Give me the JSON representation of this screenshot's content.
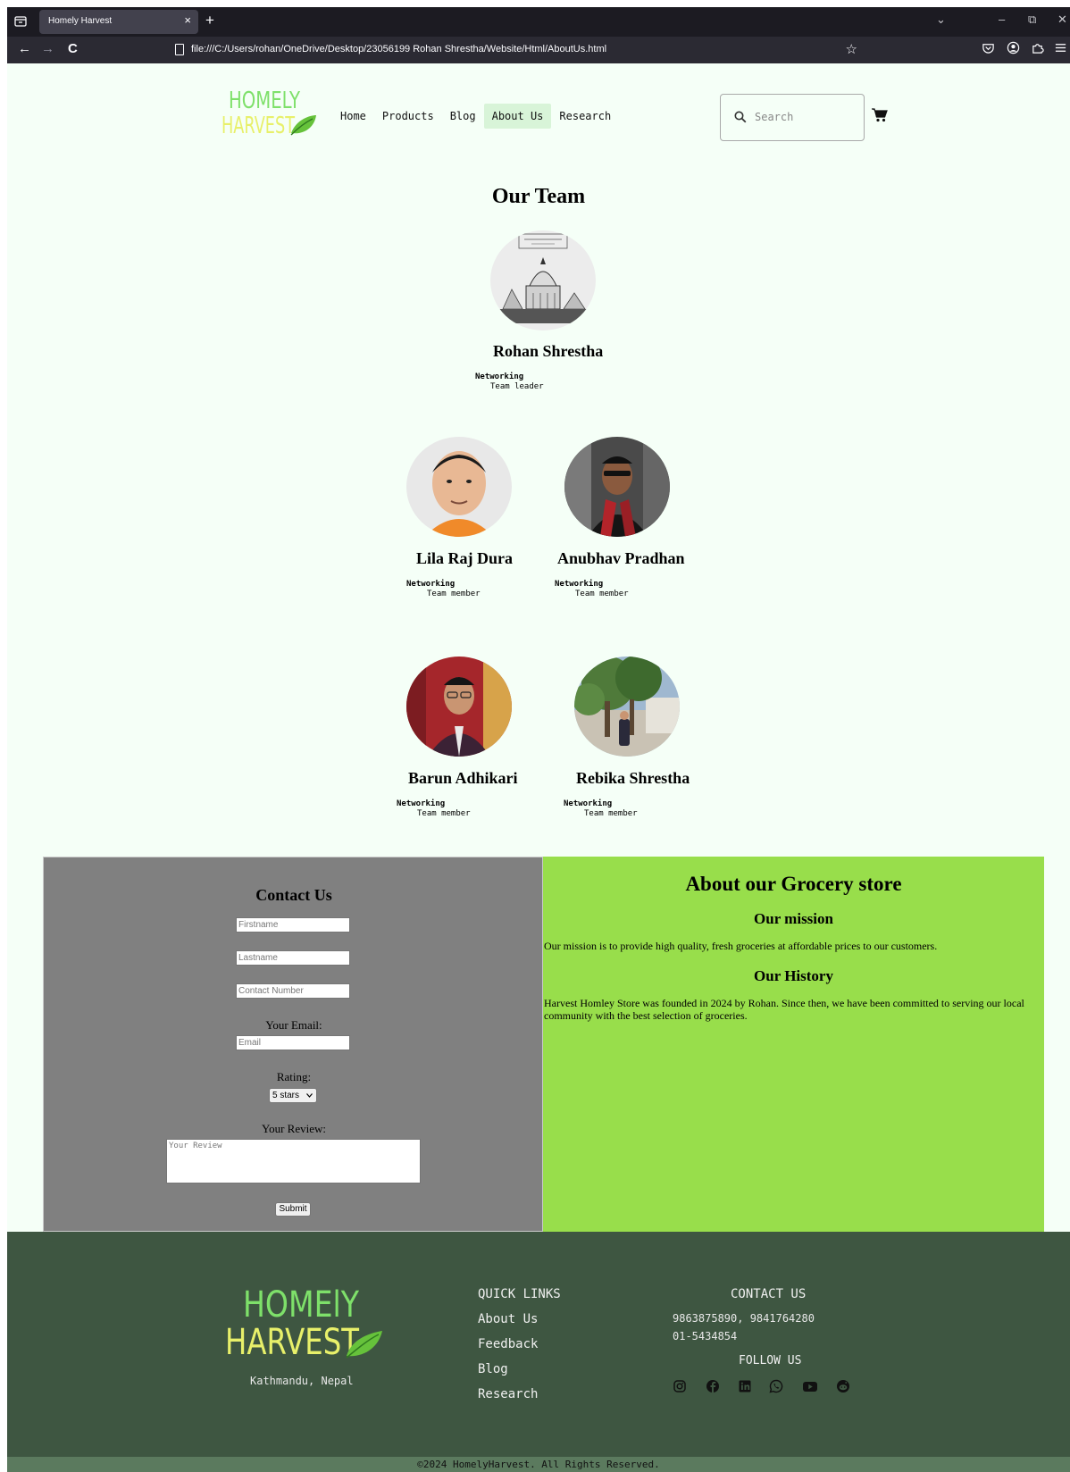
{
  "browser": {
    "tab_title": "Homely Harvest",
    "tab_close": "×",
    "new_tab": "+",
    "url": "file:///C:/Users/rohan/OneDrive/Desktop/23056199 Rohan Shrestha/Website/Html/AboutUs.html",
    "back": "←",
    "forward": "→",
    "reload": "C",
    "star": "☆",
    "win_list": "⌄",
    "win_min": "–",
    "win_restore": "⧉",
    "win_close": "✕"
  },
  "header": {
    "logo_line1": "HOMELY",
    "logo_line2": "HARVEST",
    "menu": [
      {
        "label": "Home"
      },
      {
        "label": "Products"
      },
      {
        "label": "Blog"
      },
      {
        "label": "About Us"
      },
      {
        "label": "Research"
      }
    ],
    "search_placeholder": "Search"
  },
  "team": {
    "title": "Our Team",
    "members": [
      {
        "name": "Rohan Shrestha",
        "dept": "Networking",
        "role": "Team leader"
      },
      {
        "name": "Lila Raj Dura",
        "dept": "Networking",
        "role": "Team member"
      },
      {
        "name": "Anubhav Pradhan",
        "dept": "Networking",
        "role": "Team member"
      },
      {
        "name": "Barun Adhikari",
        "dept": "Networking",
        "role": "Team member"
      },
      {
        "name": "Rebika Shrestha",
        "dept": "Networking",
        "role": "Team member"
      }
    ]
  },
  "contact": {
    "title": "Contact Us",
    "firstname_placeholder": "Firstname",
    "lastname_placeholder": "Lastname",
    "contact_placeholder": "Contact Number",
    "email_label": "Your Email:",
    "email_placeholder": "Email",
    "rating_label": "Rating:",
    "rating_value": "5 stars",
    "review_label": "Your Review:",
    "review_placeholder": "Your Review",
    "submit_label": "Submit"
  },
  "about": {
    "title": "About our Grocery store",
    "mission_heading": "Our mission",
    "mission_text": "Our mission is to provide high quality, fresh groceries at affordable prices to our customers.",
    "history_heading": "Our History",
    "history_text": "Harvest Homley Store was founded in 2024 by Rohan. Since then, we have been committed to serving our local community with the best selection of groceries."
  },
  "footer": {
    "logo_line1": "HOMElY",
    "logo_line2": "HARVEST",
    "city": "Kathmandu, Nepal",
    "quick_links_heading": "QUICK LINKS",
    "links": [
      {
        "label": "About Us"
      },
      {
        "label": "Feedback"
      },
      {
        "label": "Blog"
      },
      {
        "label": "Research"
      }
    ],
    "contact_heading": "CONTACT US",
    "phones": "9863875890, 9841764280",
    "landline": "01-5434854",
    "follow_heading": "FOLLOW US",
    "social": [
      "instagram-icon",
      "facebook-icon",
      "linkedin-icon",
      "whatsapp-icon",
      "youtube-icon",
      "reddit-icon"
    ],
    "copyright": "©2024 HomelyHarvest. All Rights Reserved."
  },
  "colors": {
    "page_bg": "#f5fff7",
    "contact_bg": "#808080",
    "about_bg": "#98de4b",
    "footer_bg": "#3e5641",
    "logo_green": "#7ee06a",
    "logo_yellow": "#e8f06a"
  }
}
